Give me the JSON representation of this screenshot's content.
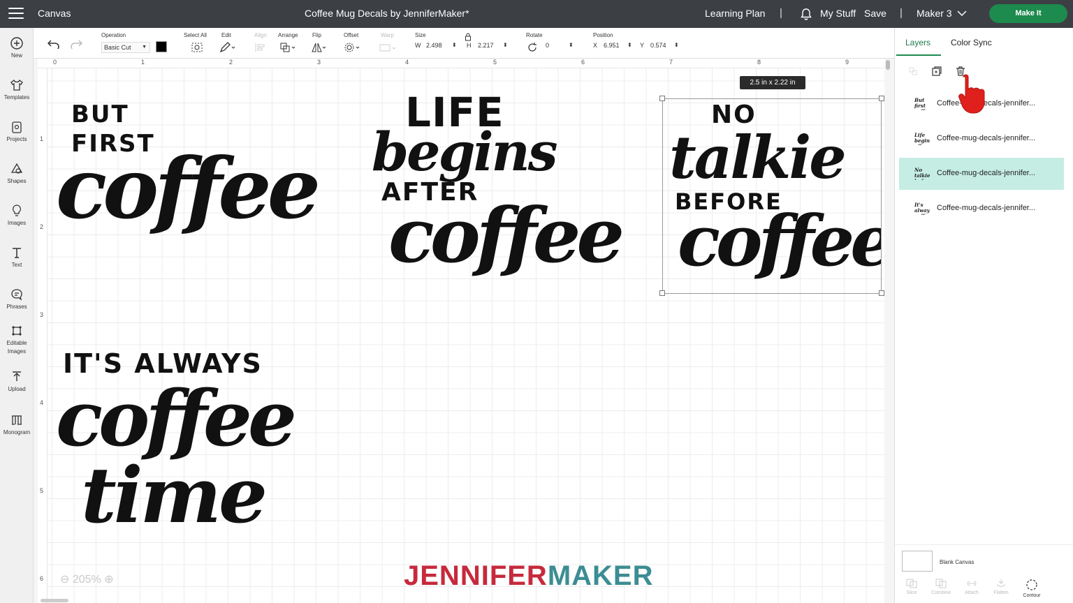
{
  "topbar": {
    "app_title": "Canvas",
    "project_title": "Coffee Mug Decals by JenniferMaker*",
    "learning_plan": "Learning Plan",
    "separator": "|",
    "my_stuff": "My Stuff",
    "save": "Save",
    "machine": "Maker 3",
    "make_it": "Make It"
  },
  "sidebar": {
    "items": [
      {
        "label": "New",
        "icon": "plus-circle-icon"
      },
      {
        "label": "Templates",
        "icon": "shirt-icon"
      },
      {
        "label": "Projects",
        "icon": "projects-icon"
      },
      {
        "label": "Shapes",
        "icon": "shapes-icon"
      },
      {
        "label": "Images",
        "icon": "lightbulb-icon"
      },
      {
        "label": "Text",
        "icon": "text-icon"
      },
      {
        "label": "Phrases",
        "icon": "speech-bubble-icon"
      },
      {
        "label": "Editable",
        "label2": "Images",
        "icon": "editable-images-icon"
      },
      {
        "label": "Upload",
        "icon": "upload-icon"
      },
      {
        "label": "Monogram",
        "icon": "monogram-icon"
      }
    ]
  },
  "toolbar": {
    "operation_label": "Operation",
    "operation_value": "Basic Cut",
    "select_all": "Select All",
    "edit": "Edit",
    "align": "Align",
    "arrange": "Arrange",
    "flip": "Flip",
    "offset": "Offset",
    "warp": "Warp",
    "size_label": "Size",
    "w_label": "W",
    "w_value": "2.498",
    "h_label": "H",
    "h_value": "2.217",
    "rotate_label": "Rotate",
    "rotate_value": "0",
    "position_label": "Position",
    "x_label": "X",
    "x_value": "6.951",
    "y_label": "Y",
    "y_value": "0.574",
    "operation_color": "#000000"
  },
  "ruler": {
    "top": [
      "0",
      "1",
      "2",
      "3",
      "4",
      "5",
      "6",
      "7",
      "8",
      "9"
    ],
    "left": [
      "1",
      "2",
      "3",
      "4",
      "5",
      "6"
    ]
  },
  "designs": {
    "d1": {
      "line1": "BUT",
      "line2": "FIRST",
      "line3": "coffee"
    },
    "d2": {
      "line1": "LIFE",
      "line2": "begins",
      "line3": "AFTER",
      "line4": "coffee"
    },
    "d3": {
      "line1": "NO",
      "line2": "talkie",
      "line3": "BEFORE",
      "line4": "coffee"
    },
    "d4": {
      "line1": "IT'S ALWAYS",
      "line2": "coffee",
      "line3": "time"
    }
  },
  "size_tooltip": "2.5  in x 2.22  in",
  "zoom": {
    "minus": "⊖",
    "value": "205%",
    "plus": "⊕"
  },
  "watermark": {
    "part1": "JENNIFER",
    "part2": "MAKER"
  },
  "panel": {
    "tabs": [
      "Layers",
      "Color Sync"
    ],
    "layers": [
      {
        "name": "Coffee-mug-decals-jennifer...",
        "thumb": "But first coffee"
      },
      {
        "name": "Coffee-mug-decals-jennifer...",
        "thumb": "Life begins after coffee"
      },
      {
        "name": "Coffee-mug-decals-jennifer...",
        "thumb": "No talkie before coffee"
      },
      {
        "name": "Coffee-mug-decals-jennifer...",
        "thumb": "It's always coffee time"
      }
    ],
    "blank_canvas": "Blank Canvas",
    "bottom_tools": [
      "Slice",
      "Combine",
      "Attach",
      "Flatten",
      "Contour"
    ]
  },
  "colors": {
    "accent_green": "#1d8a4e",
    "selected_layer": "#c6ede3",
    "pointer_red": "#e0201c",
    "watermark_red": "#c62a3c",
    "watermark_teal": "#3b8d93"
  }
}
